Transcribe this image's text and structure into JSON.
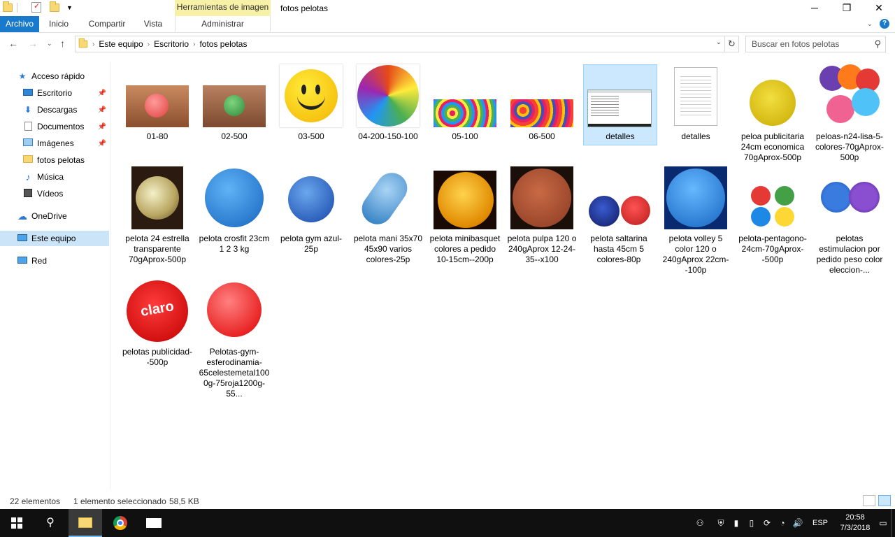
{
  "titlebar": {
    "tools_tab": "Herramientas de imagen",
    "title": "fotos pelotas",
    "minimize_icon": "minimize-icon",
    "maximize_icon": "restore-icon",
    "close_icon": "close-icon"
  },
  "ribbon": {
    "tabs": [
      "Archivo",
      "Inicio",
      "Compartir",
      "Vista"
    ],
    "admin_tab": "Administrar"
  },
  "address": {
    "crumbs": [
      "Este equipo",
      "Escritorio",
      "fotos pelotas"
    ],
    "search_placeholder": "Buscar en fotos pelotas"
  },
  "nav": {
    "quick_access": "Acceso rápido",
    "items": [
      "Escritorio",
      "Descargas",
      "Documentos",
      "Imágenes",
      "fotos pelotas",
      "Música",
      "Vídeos"
    ],
    "onedrive": "OneDrive",
    "this_pc": "Este equipo",
    "network": "Red"
  },
  "files": [
    {
      "name": "01-80"
    },
    {
      "name": "02-500"
    },
    {
      "name": "03-500"
    },
    {
      "name": "04-200-150-100"
    },
    {
      "name": "05-100"
    },
    {
      "name": "06-500"
    },
    {
      "name": "detalles"
    },
    {
      "name": "detalles"
    },
    {
      "name": "peloa publicitaria 24cm economica 70gAprox-500p"
    },
    {
      "name": "peloas-n24-lisa-5-colores-70gAprox-500p"
    },
    {
      "name": "pelota 24 estrella transparente 70gAprox-500p"
    },
    {
      "name": "pelota crosfit 23cm 1 2 3 kg"
    },
    {
      "name": "pelota gym azul-25p"
    },
    {
      "name": "pelota mani 35x70  45x90 varios colores-25p"
    },
    {
      "name": "pelota minibasquet colores a pedido 10-15cm--200p"
    },
    {
      "name": "pelota pulpa 120 o 240gAprox 12-24-35--x100"
    },
    {
      "name": "pelota saltarina hasta 45cm 5 colores-80p"
    },
    {
      "name": "pelota volley 5 color 120 o 240gAprox 22cm--100p"
    },
    {
      "name": "pelota-pentagono-24cm-70gAprox--500p"
    },
    {
      "name": "pelotas estimulacion por pedido peso color eleccion-..."
    },
    {
      "name": "pelotas publicidad--500p"
    },
    {
      "name": "Pelotas-gym-esferodinamia-65celestemetal1000g-75roja1200g-55..."
    }
  ],
  "thumb_texts": {
    "claro": "claro"
  },
  "status": {
    "count": "22 elementos",
    "selection": "1 elemento seleccionado",
    "size": "58,5 KB"
  },
  "taskbar": {
    "lang": "ESP",
    "time": "20:58",
    "date": "7/3/2018"
  },
  "colors": {
    "accent": "#1979ca",
    "selection": "#cce8ff",
    "tools_tab": "#f7f1a8"
  }
}
